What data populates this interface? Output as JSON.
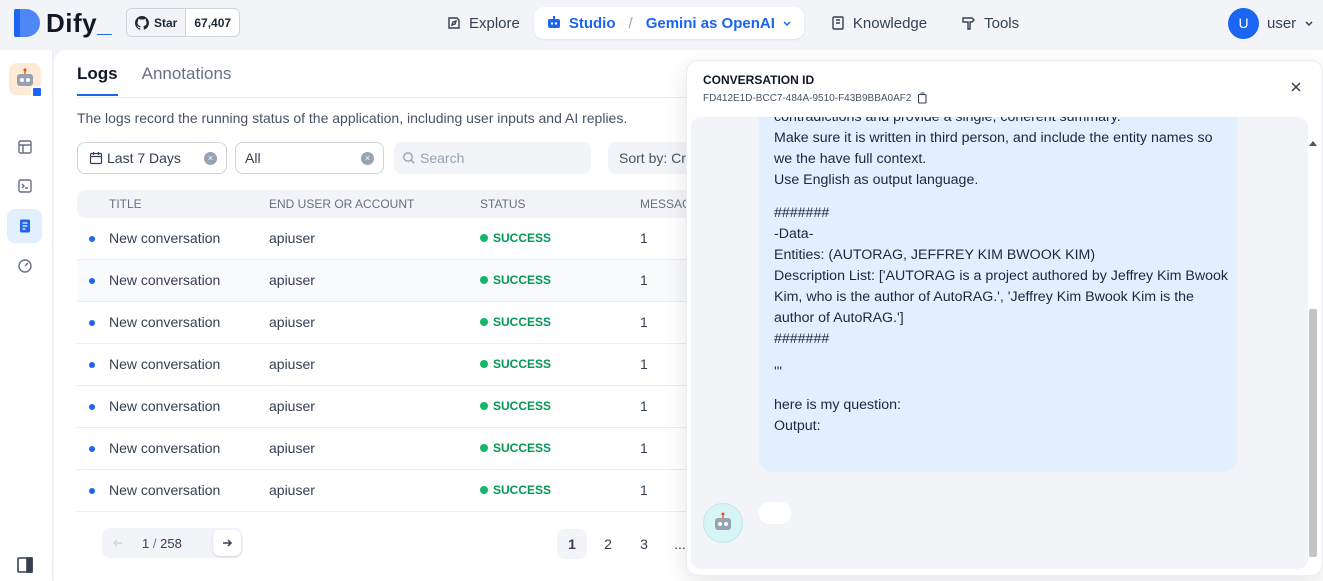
{
  "brand": {
    "name": "Dify",
    "underscore": "_"
  },
  "github": {
    "star_label": "Star",
    "star_count": "67,407"
  },
  "nav": {
    "explore": "Explore",
    "studio": "Studio",
    "separator": "/",
    "app_name": "Gemini as OpenAI",
    "knowledge": "Knowledge",
    "tools": "Tools"
  },
  "user": {
    "initial": "U",
    "name": "user"
  },
  "tabs": {
    "logs": "Logs",
    "annotations": "Annotations"
  },
  "description": "The logs record the running status of the application, including user inputs and AI replies.",
  "filters": {
    "date_value": "Last 7 Days",
    "status_value": "All",
    "search_placeholder": "Search",
    "sort_label": "Sort by:",
    "sort_value": "Cr"
  },
  "table": {
    "columns": [
      "TITLE",
      "END USER OR ACCOUNT",
      "STATUS",
      "MESSAG"
    ],
    "rows": [
      {
        "title": "New conversation",
        "user": "apiuser",
        "status": "SUCCESS",
        "messages": "1"
      },
      {
        "title": "New conversation",
        "user": "apiuser",
        "status": "SUCCESS",
        "messages": "1"
      },
      {
        "title": "New conversation",
        "user": "apiuser",
        "status": "SUCCESS",
        "messages": "1"
      },
      {
        "title": "New conversation",
        "user": "apiuser",
        "status": "SUCCESS",
        "messages": "1"
      },
      {
        "title": "New conversation",
        "user": "apiuser",
        "status": "SUCCESS",
        "messages": "1"
      },
      {
        "title": "New conversation",
        "user": "apiuser",
        "status": "SUCCESS",
        "messages": "1"
      },
      {
        "title": "New conversation",
        "user": "apiuser",
        "status": "SUCCESS",
        "messages": "1"
      }
    ]
  },
  "pagination": {
    "current": "1",
    "total": "258",
    "pages": [
      "1",
      "2",
      "3",
      "..."
    ],
    "prev_icon": "arrow-left-icon",
    "next_icon": "arrow-right-icon"
  },
  "drawer": {
    "title": "CONVERSATION ID",
    "conversation_id": "FD412E1D-BCC7-484A-9510-F43B9BBA0AF2",
    "message_lines": [
      "contradictions and provide a single, coherent summary.",
      "Make sure it is written in third person, and include the entity names so we the have full context.",
      "Use English as output language.",
      "",
      "#######",
      "-Data-",
      "Entities: (AUTORAG, JEFFREY KIM BWOOK KIM)",
      "Description List: ['AUTORAG is a project authored by Jeffrey Kim Bwook Kim, who is the author of AutoRAG.', 'Jeffrey Kim Bwook Kim is the author of AutoRAG.']",
      "#######",
      "",
      "'''",
      "",
      "here is my question:",
      "Output:"
    ]
  },
  "colors": {
    "accent": "#1c64f2",
    "success": "#039855",
    "bubble": "#e1effe",
    "page_bg": "#f2f4f7"
  }
}
